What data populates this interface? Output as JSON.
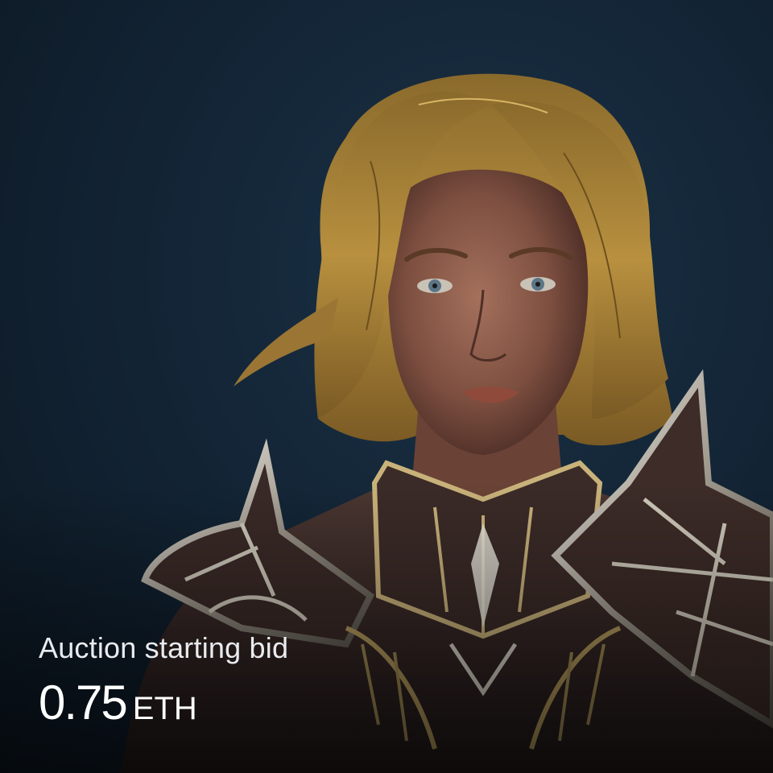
{
  "artwork": {
    "subject": "portrait-knight",
    "colors": {
      "background": "#132536",
      "hair": "#b8903f",
      "skin": "#8a5a48",
      "armor_dark": "#3a2a27",
      "armor_trim": "#c9b27a",
      "armor_silver": "#d9d4c8"
    }
  },
  "auction": {
    "caption": "Auction starting bid",
    "amount": "0.75",
    "currency": "ETH"
  }
}
